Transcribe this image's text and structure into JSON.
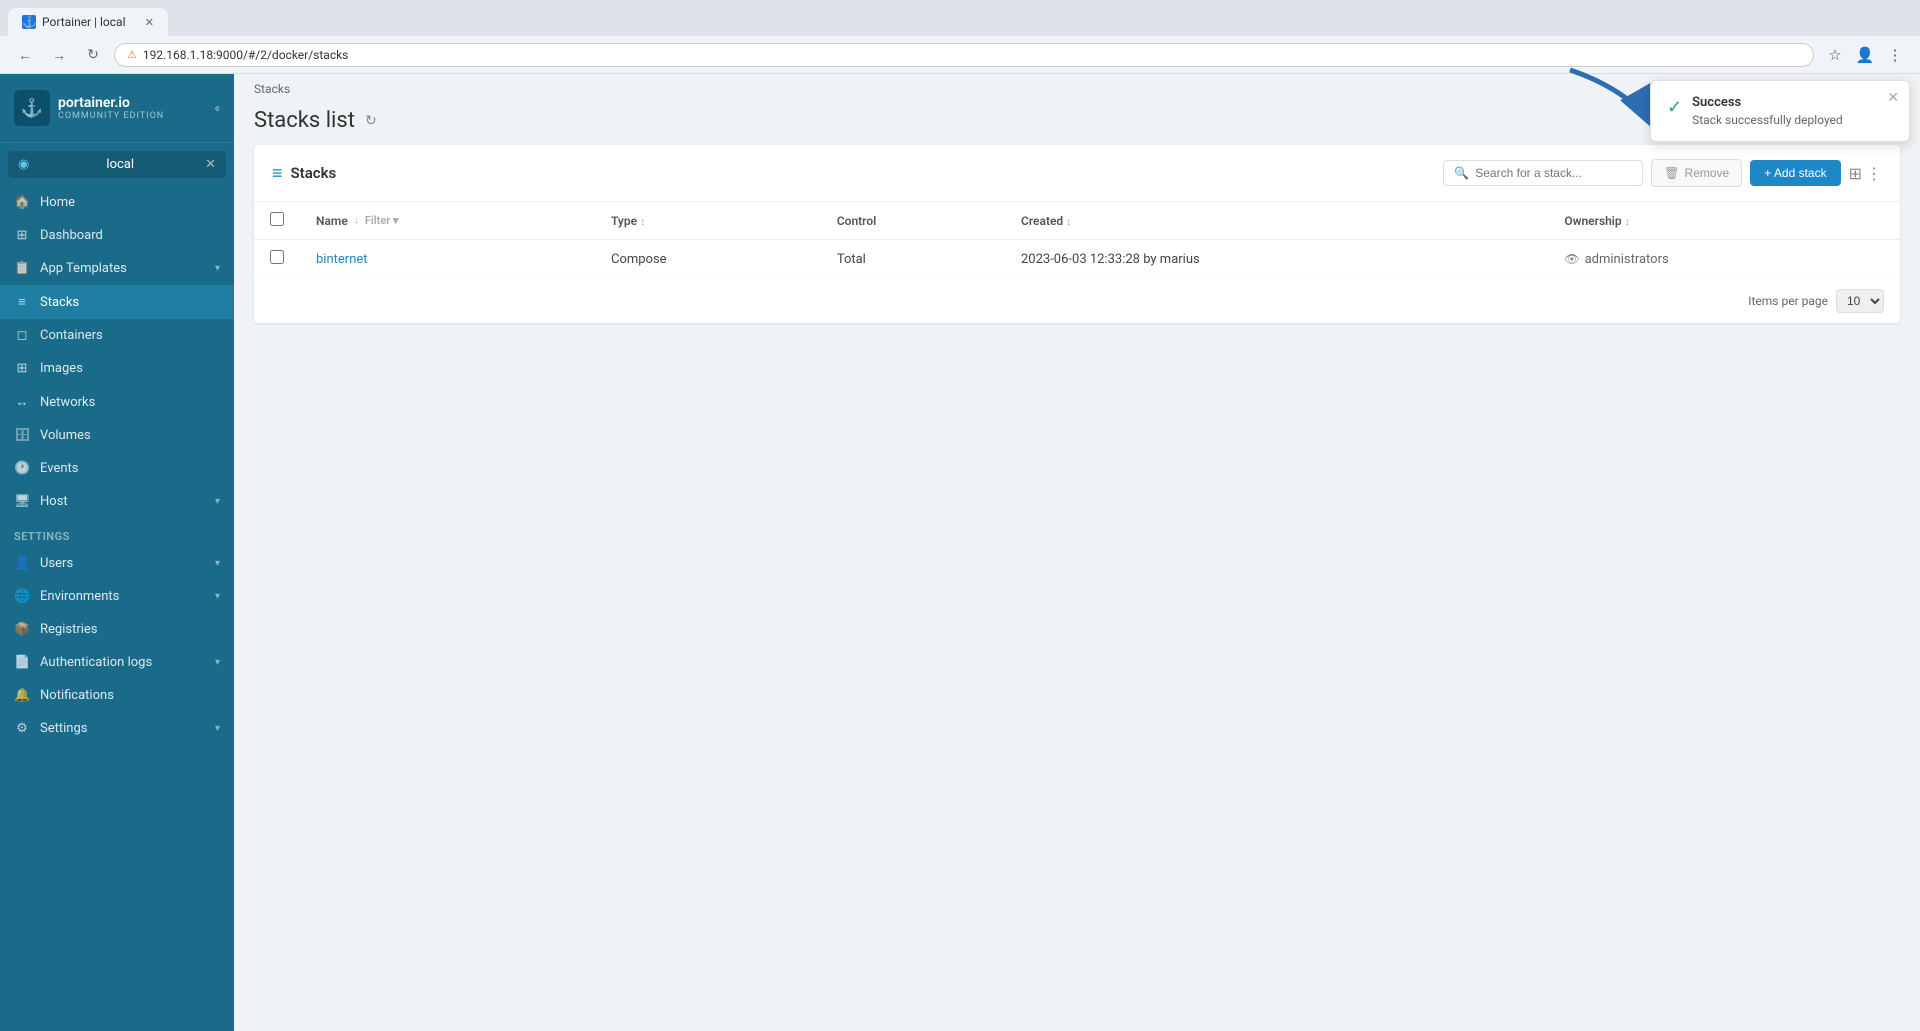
{
  "browser": {
    "tab_title": "Portainer | local",
    "tab_favicon": "P",
    "address": "192.168.1.18:9000/#/2/docker/stacks",
    "security_label": "Not secure"
  },
  "sidebar": {
    "logo_name": "portainer.io",
    "logo_sub": "COMMUNITY EDITION",
    "env_name": "local",
    "nav_items": [
      {
        "id": "home",
        "label": "Home",
        "icon": "🏠"
      },
      {
        "id": "dashboard",
        "label": "Dashboard",
        "icon": "📊"
      },
      {
        "id": "app-templates",
        "label": "App Templates",
        "icon": "📋",
        "arrow": "▾"
      },
      {
        "id": "stacks",
        "label": "Stacks",
        "icon": "≡",
        "active": true
      },
      {
        "id": "containers",
        "label": "Containers",
        "icon": "◻"
      },
      {
        "id": "images",
        "label": "Images",
        "icon": "⊞"
      },
      {
        "id": "networks",
        "label": "Networks",
        "icon": "↔"
      },
      {
        "id": "volumes",
        "label": "Volumes",
        "icon": "🗄"
      },
      {
        "id": "events",
        "label": "Events",
        "icon": "🕐"
      },
      {
        "id": "host",
        "label": "Host",
        "icon": "🖥",
        "arrow": "▾"
      }
    ],
    "settings_label": "Settings",
    "settings_items": [
      {
        "id": "users",
        "label": "Users",
        "icon": "👤",
        "arrow": "▾"
      },
      {
        "id": "environments",
        "label": "Environments",
        "icon": "🌐",
        "arrow": "▾"
      },
      {
        "id": "registries",
        "label": "Registries",
        "icon": "📦"
      },
      {
        "id": "auth-logs",
        "label": "Authentication logs",
        "icon": "📄",
        "arrow": "▾"
      },
      {
        "id": "notifications",
        "label": "Notifications",
        "icon": "🔔"
      },
      {
        "id": "settings",
        "label": "Settings",
        "icon": "⚙",
        "arrow": "▾"
      }
    ]
  },
  "breadcrumb": "Stacks",
  "page_title": "Stacks list",
  "card": {
    "title": "Stacks",
    "search_placeholder": "Search for a stack...",
    "btn_remove": "Remove",
    "btn_add": "+ Add stack",
    "table": {
      "columns": [
        "Name",
        "Type",
        "Control",
        "Created",
        "Ownership"
      ],
      "rows": [
        {
          "name": "binternet",
          "type": "Compose",
          "control": "Total",
          "created": "2023-06-03 12:33:28 by marius",
          "ownership": "administrators"
        }
      ]
    },
    "items_per_page_label": "Items per page",
    "items_per_page_value": "10"
  },
  "toast": {
    "title": "Success",
    "message": "Stack successfully deployed",
    "icon": "✓"
  }
}
